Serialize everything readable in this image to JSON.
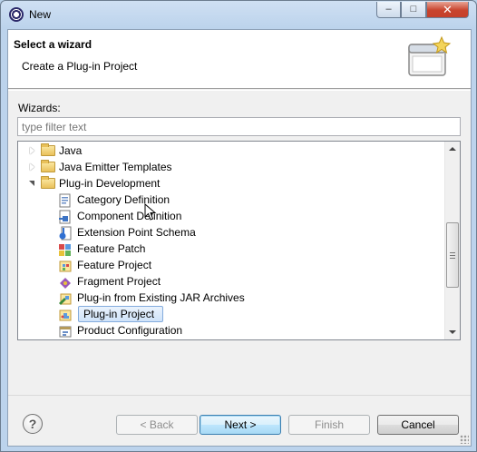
{
  "window": {
    "title": "New"
  },
  "titlebar_buttons": {
    "minimize": "–",
    "maximize": "□",
    "close": "✕"
  },
  "header": {
    "title": "Select a wizard",
    "description": "Create a Plug-in Project"
  },
  "wizards_label": "Wizards:",
  "filter": {
    "placeholder": "type filter text",
    "value": ""
  },
  "tree": {
    "items": [
      {
        "label": "Java",
        "kind": "folder",
        "state": "collapsed"
      },
      {
        "label": "Java Emitter Templates",
        "kind": "folder",
        "state": "collapsed"
      },
      {
        "label": "Plug-in Development",
        "kind": "folder",
        "state": "expanded"
      },
      {
        "label": "Category Definition",
        "kind": "item",
        "icon": "category-definition-icon"
      },
      {
        "label": "Component Definition",
        "kind": "item",
        "icon": "component-definition-icon"
      },
      {
        "label": "Extension Point Schema",
        "kind": "item",
        "icon": "extension-point-schema-icon"
      },
      {
        "label": "Feature Patch",
        "kind": "item",
        "icon": "feature-patch-icon"
      },
      {
        "label": "Feature Project",
        "kind": "item",
        "icon": "feature-project-icon"
      },
      {
        "label": "Fragment Project",
        "kind": "item",
        "icon": "fragment-project-icon"
      },
      {
        "label": "Plug-in from Existing JAR Archives",
        "kind": "item",
        "icon": "plugin-from-jar-icon"
      },
      {
        "label": "Plug-in Project",
        "kind": "item",
        "icon": "plugin-project-icon",
        "selected": true
      },
      {
        "label": "Product Configuration",
        "kind": "item",
        "icon": "product-configuration-icon"
      }
    ]
  },
  "buttons": {
    "help": "?",
    "back": "< Back",
    "next": "Next >",
    "finish": "Finish",
    "cancel": "Cancel"
  },
  "colors": {
    "selection": "#cfe3f9",
    "titlebar": "#bcd3ec",
    "close": "#c8432c"
  }
}
